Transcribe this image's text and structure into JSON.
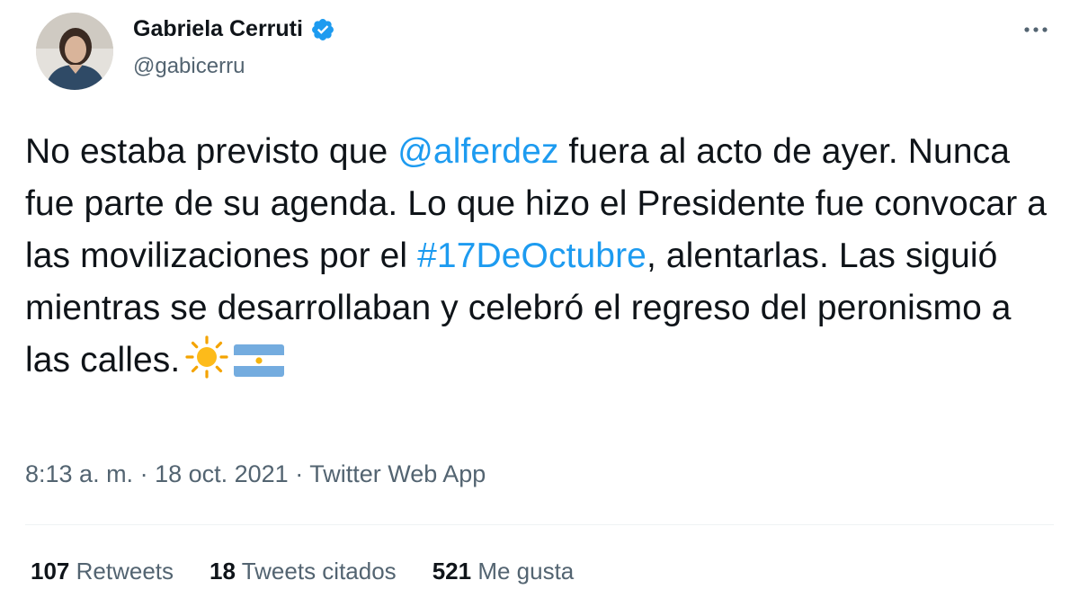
{
  "author": {
    "display_name": "Gabriela Cerruti",
    "handle": "@gabicerru",
    "verified": true,
    "avatar_icon": "profile-photo"
  },
  "tweet": {
    "text_part1": "No estaba previsto que ",
    "mention": "@alferdez",
    "text_part2": " fuera al acto de ayer. Nunca fue parte de su agenda. Lo que hizo el Presidente fue convocar a las movilizaciones por el ",
    "hashtag": "#17DeOctubre",
    "text_part3": ", alentarlas. Las siguió mientras se desarrollaban y celebró el regreso del peronismo a las calles.",
    "emojis": [
      "sun-icon",
      "argentina-flag-icon"
    ]
  },
  "meta": {
    "time": "8:13 a. m.",
    "separator": " · ",
    "date": "18 oct. 2021",
    "source": "Twitter Web App"
  },
  "stats": {
    "retweets_count": "107",
    "retweets_label": "Retweets",
    "quotes_count": "18",
    "quotes_label": "Tweets citados",
    "likes_count": "521",
    "likes_label": "Me gusta"
  },
  "colors": {
    "link": "#1d9bf0",
    "secondary": "#536471",
    "primary": "#0f1419",
    "verified": "#1d9bf0"
  }
}
